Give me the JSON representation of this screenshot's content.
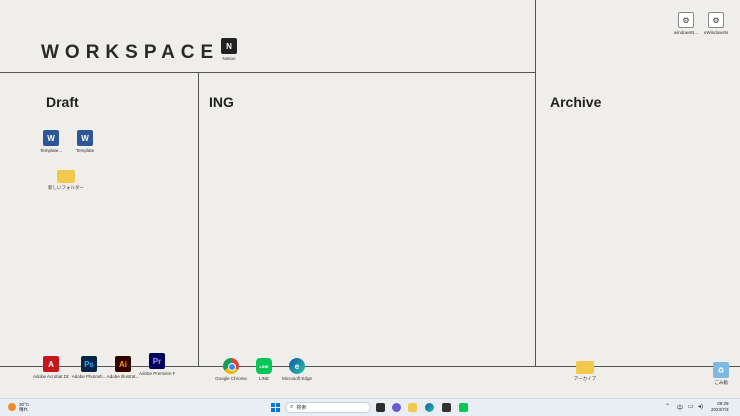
{
  "workspace": {
    "title": "WORKSPACE",
    "sections": {
      "draft": "Draft",
      "ing": "ING",
      "archive": "Archive"
    },
    "notion_caption": "Notion"
  },
  "topright_icons": [
    {
      "label": "windowsN...",
      "icon": "shortcut-icon"
    },
    {
      "label": "eWindowsN",
      "icon": "shortcut-icon"
    }
  ],
  "draft_icons": [
    {
      "label": "Template...",
      "icon": "word-doc-icon"
    },
    {
      "label": "Template",
      "icon": "word-doc-icon"
    },
    {
      "label": "新しいフォルダー",
      "icon": "folder-icon"
    }
  ],
  "bottom_icons": [
    {
      "label": "Adobe Acrobat DC",
      "icon": "acrobat-icon",
      "glyph": "A"
    },
    {
      "label": "Adobe Photosh...",
      "icon": "photoshop-icon",
      "glyph": "Ps"
    },
    {
      "label": "Adobe Illustrat...",
      "icon": "illustrator-icon",
      "glyph": "Ai"
    },
    {
      "label": "Adobe Premiere P...",
      "icon": "premiere-icon",
      "glyph": "Pr"
    },
    {
      "label": "Google Chrome",
      "icon": "chrome-icon",
      "glyph": ""
    },
    {
      "label": "LINE",
      "icon": "line-icon",
      "glyph": "LINE"
    },
    {
      "label": "Microsoft Edge",
      "icon": "edge-icon",
      "glyph": "e"
    },
    {
      "label": "アーカイブ",
      "icon": "folder-icon",
      "glyph": ""
    },
    {
      "label": "ごみ箱",
      "icon": "recycle-bin-icon",
      "glyph": "♻"
    }
  ],
  "taskbar": {
    "weather_temp": "30°C",
    "weather_desc": "晴れ",
    "search_placeholder": "検索",
    "tray_ime": "中",
    "time": "09:29",
    "date": "2023/7/3"
  },
  "colors": {
    "background": "#f0eeea",
    "divider": "#555555",
    "taskbar": "#e8eef4"
  }
}
